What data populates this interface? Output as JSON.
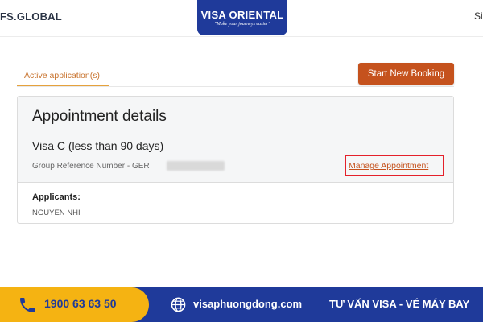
{
  "header": {
    "vfs_logo": "FS.GLOBAL",
    "signin_label": "Sign in",
    "brand": {
      "name": "VISA ORIENTAL",
      "tagline": "\"Make your journeys easier\""
    }
  },
  "tabs": [
    {
      "label": "Active application(s)",
      "active": true
    }
  ],
  "toolbar": {
    "start_booking_label": "Start New Booking"
  },
  "appointment": {
    "title": "Appointment details",
    "visa_type": "Visa C (less than 90 days)",
    "group_reference_label": "Group Reference Number - GER",
    "manage_label": "Manage Appointment",
    "applicants_label": "Applicants:",
    "applicants": [
      "NGUYEN NHI"
    ]
  },
  "banner": {
    "phone": "1900 63 63 50",
    "website": "visaphuongdong.com",
    "slogan": "TƯ VẤN VISA - VÉ MÁY BAY"
  },
  "colors": {
    "accent_orange": "#c5521d",
    "tab_underline": "#e6a23c",
    "highlight_red": "#e4202a",
    "brand_blue": "#1f3a9a",
    "banner_yellow": "#f5b312"
  },
  "icons": [
    "phone-icon",
    "globe-icon"
  ]
}
